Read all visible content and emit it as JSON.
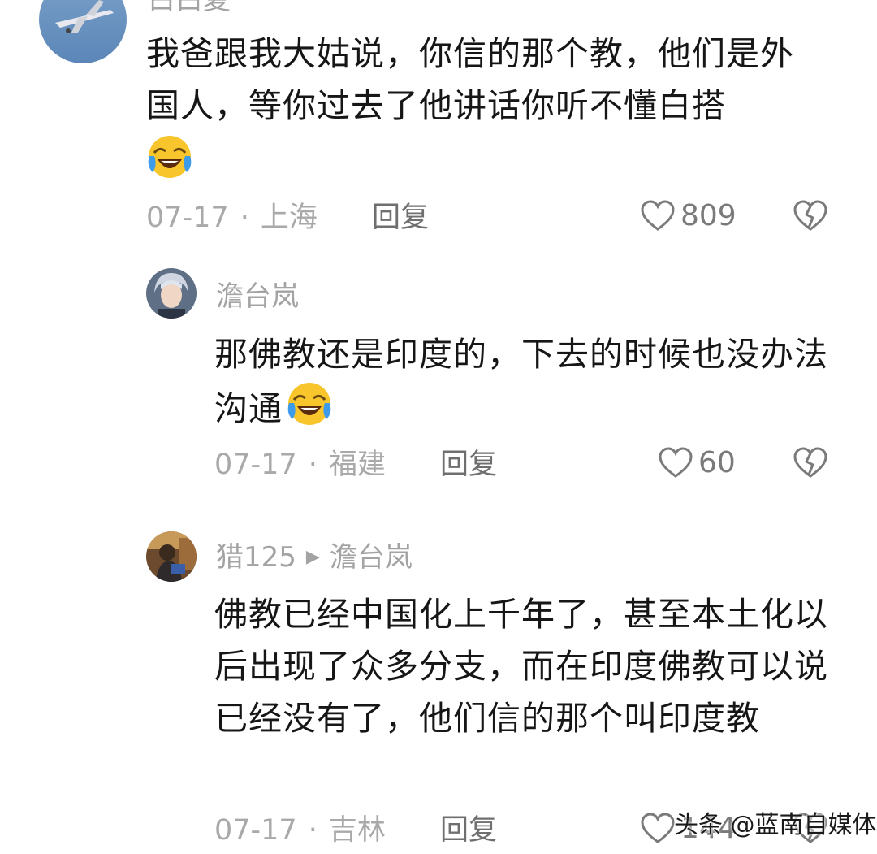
{
  "comments": [
    {
      "username": "白白夏",
      "text": "我爸跟我大姑说，你信的那个教，他们是外国人，等你过去了他讲话你听不懂白搭",
      "emoji": "laughing-crying-emoji",
      "date": "07-17",
      "separator": "·",
      "location": "上海",
      "reply_label": "回复",
      "likes": "809"
    },
    {
      "username": "澹台岚",
      "text": "那佛教还是印度的，下去的时候也没办法沟通",
      "emoji": "laughing-crying-emoji",
      "date": "07-17",
      "separator": "·",
      "location": "福建",
      "reply_label": "回复",
      "likes": "60"
    },
    {
      "username": "猎125",
      "reply_to": "澹台岚",
      "reply_arrow": "▶",
      "text": "佛教已经中国化上千年了，甚至本土化以后出现了众多分支，而在印度佛教可以说已经没有了，他们信的那个叫印度教",
      "date": "07-17",
      "separator": "·",
      "location": "吉林",
      "reply_label": "回复",
      "likes": "144"
    }
  ],
  "watermark": "头条 @蓝南自媒体",
  "colors": {
    "text": "#161616",
    "meta": "#a9a9a9",
    "icon": "#7a7a7a"
  }
}
